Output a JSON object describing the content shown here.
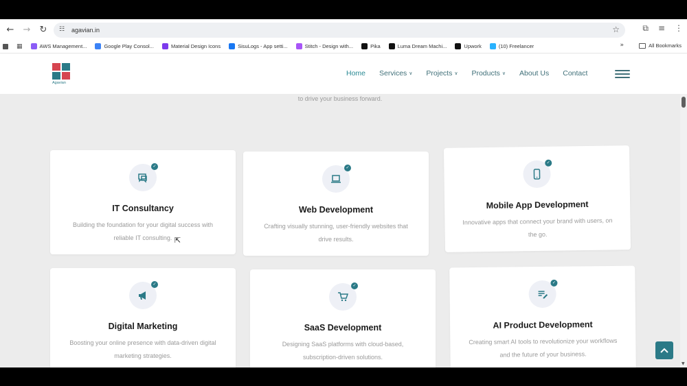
{
  "browser": {
    "url": "agavian.in",
    "bookmarks": [
      {
        "label": "AWS Management...",
        "color": "#8b5cf6"
      },
      {
        "label": "Google Play Consol...",
        "color": "#3b82f6"
      },
      {
        "label": "Material Design Icons",
        "color": "#7c3aed"
      },
      {
        "label": "SisuLogs - App setti...",
        "color": "#1877f2"
      },
      {
        "label": "Stitch - Design with...",
        "color": "#a855f7"
      },
      {
        "label": "Pika",
        "color": "#111111"
      },
      {
        "label": "Luma Dream Machi...",
        "color": "#111111"
      },
      {
        "label": "Upwork",
        "color": "#111111"
      },
      {
        "label": "(10) Freelancer",
        "color": "#29b2fe"
      }
    ],
    "all_bookmarks": "All Bookmarks"
  },
  "site": {
    "logo_text": "Agavian",
    "nav": [
      {
        "label": "Home",
        "has_dropdown": false,
        "active": true
      },
      {
        "label": "Services",
        "has_dropdown": true,
        "active": false
      },
      {
        "label": "Projects",
        "has_dropdown": true,
        "active": false
      },
      {
        "label": "Products",
        "has_dropdown": true,
        "active": false
      },
      {
        "label": "About Us",
        "has_dropdown": false,
        "active": false
      },
      {
        "label": "Contact",
        "has_dropdown": false,
        "active": false
      }
    ],
    "tagline": "to drive your business forward."
  },
  "services": [
    {
      "title": "IT Consultancy",
      "desc": "Building the foundation for your digital success with reliable IT consulting.",
      "icon": "chat-icon"
    },
    {
      "title": "Web Development",
      "desc": "Crafting visually stunning, user-friendly websites that drive results.",
      "icon": "laptop-icon"
    },
    {
      "title": "Mobile App Development",
      "desc": "Innovative apps that connect your brand with users, on the go.",
      "icon": "mobile-icon"
    },
    {
      "title": "Digital Marketing",
      "desc": "Boosting your online presence with data-driven digital marketing strategies.",
      "icon": "megaphone-icon"
    },
    {
      "title": "SaaS Development",
      "desc": "Designing SaaS platforms with cloud-based, subscription-driven solutions.",
      "icon": "cart-icon"
    },
    {
      "title": "AI Product Development",
      "desc": "Creating smart AI tools to revolutionize your workflows and the future of your business.",
      "icon": "edit-list-icon"
    }
  ],
  "colors": {
    "accent": "#2b7a87",
    "brand_red": "#d64550",
    "card_icon_bg": "#eef0f6"
  }
}
